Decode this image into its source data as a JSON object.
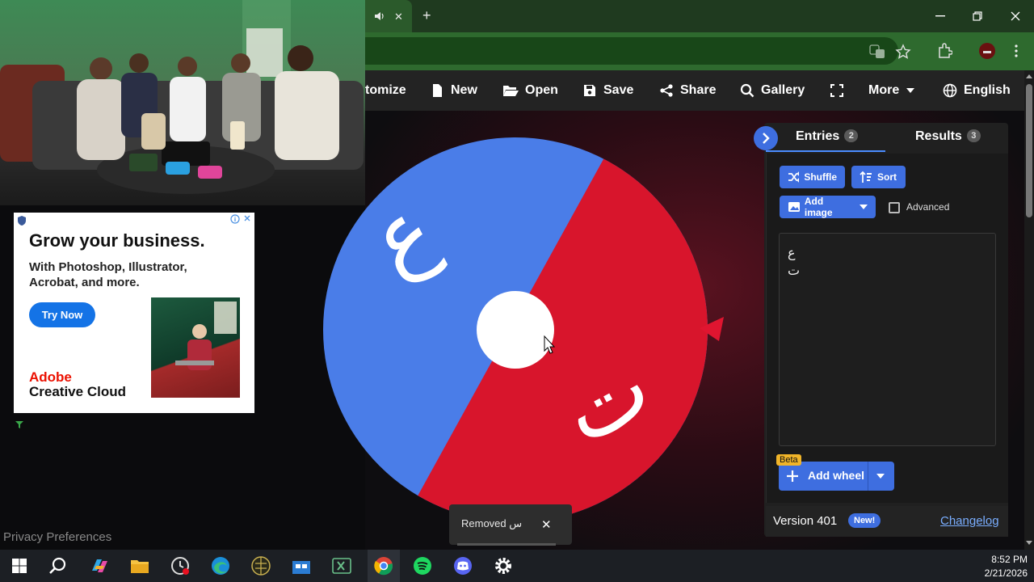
{
  "browser": {
    "tab_controls": {
      "audio_icon": "speaker-icon",
      "close_label": "✕",
      "new_tab_label": "+"
    },
    "window_controls": [
      "minimize",
      "restore",
      "close"
    ],
    "toolbar_icons": [
      "translate-icon",
      "star-icon",
      "extensions-icon",
      "profile-icon",
      "menu-icon"
    ]
  },
  "app_nav": {
    "customize": "tomize",
    "new": "New",
    "open": "Open",
    "save": "Save",
    "share": "Share",
    "gallery": "Gallery",
    "more": "More",
    "language": "English"
  },
  "ad": {
    "headline": "Grow your business.",
    "body": "With Photoshop, Illustrator, Acrobat, and more.",
    "cta": "Try Now",
    "brand_line1": "Adobe",
    "brand_line2": "Creative Cloud"
  },
  "wheel": {
    "segments": [
      {
        "label": "ع",
        "color": "#4a7de8"
      },
      {
        "label": "ت",
        "color": "#d8152c"
      }
    ]
  },
  "panel": {
    "tab_entries": "Entries",
    "entries_count": "2",
    "tab_results": "Results",
    "results_count": "3",
    "shuffle": "Shuffle",
    "sort": "Sort",
    "add_image": "Add image",
    "advanced": "Advanced",
    "entries": [
      "ع",
      "ت"
    ],
    "beta": "Beta",
    "add_wheel": "Add wheel",
    "version": "Version 401",
    "new_badge": "New!",
    "changelog": "Changelog"
  },
  "toast": {
    "message": "Removed س",
    "close": "✕"
  },
  "privacy": "Privacy Preferences",
  "taskbar": {
    "time": "8:52 PM",
    "date": "2/21/2026",
    "apps": [
      "windows-start-icon",
      "search-icon",
      "copilot-icon",
      "file-explorer-icon",
      "clock-app-icon",
      "edge-icon",
      "globe-app-icon",
      "store-icon",
      "excel-icon",
      "chrome-icon",
      "spotify-icon",
      "discord-icon",
      "settings-icon"
    ]
  },
  "colors": {
    "accent": "#3e6ee0",
    "wheel_blue": "#4a7de8",
    "wheel_red": "#d8152c",
    "chrome_green": "#2e6a2e"
  }
}
